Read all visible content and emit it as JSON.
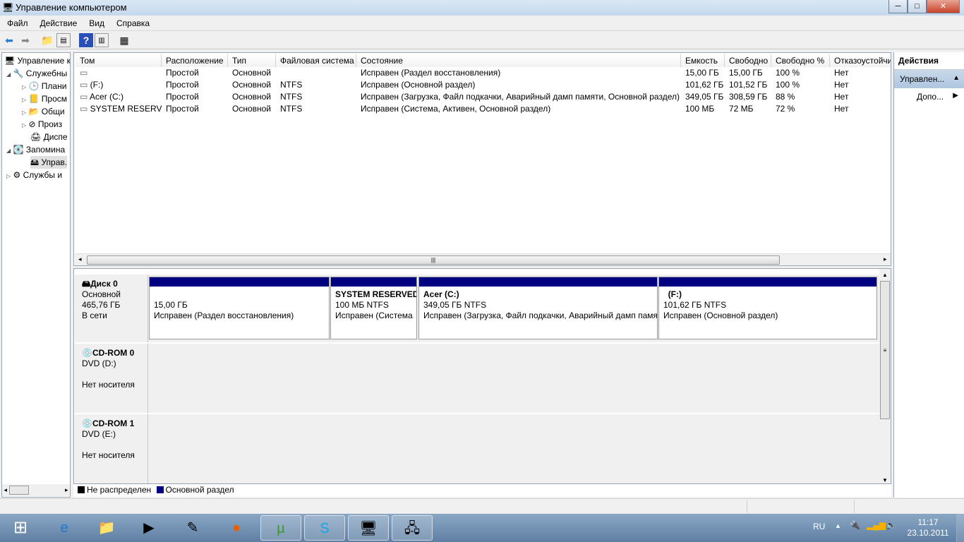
{
  "window": {
    "title": "Управление компьютером",
    "minimize": "─",
    "maximize": "□",
    "close": "✕"
  },
  "menu": [
    "Файл",
    "Действие",
    "Вид",
    "Справка"
  ],
  "tree": [
    {
      "label": "Управление к"
    },
    {
      "label": "Служебны"
    },
    {
      "label": "Плани"
    },
    {
      "label": "Просм"
    },
    {
      "label": "Общи"
    },
    {
      "label": "Произ"
    },
    {
      "label": "Диспе"
    },
    {
      "label": "Запомина"
    },
    {
      "label": "Управ."
    },
    {
      "label": "Службы и"
    }
  ],
  "list": {
    "columns": [
      "Том",
      "Расположение",
      "Тип",
      "Файловая система",
      "Состояние",
      "Емкость",
      "Свободно",
      "Свободно %",
      "Отказоустойчи"
    ],
    "rows": [
      [
        "",
        "Простой",
        "Основной",
        "",
        "Исправен (Раздел восстановления)",
        "15,00 ГБ",
        "15,00 ГБ",
        "100 %",
        "Нет"
      ],
      [
        "(F:)",
        "Простой",
        "Основной",
        "NTFS",
        "Исправен (Основной раздел)",
        "101,62 ГБ",
        "101,52 ГБ",
        "100 %",
        "Нет"
      ],
      [
        "Acer (C:)",
        "Простой",
        "Основной",
        "NTFS",
        "Исправен (Загрузка, Файл подкачки, Аварийный дамп памяти, Основной раздел)",
        "349,05 ГБ",
        "308,59 ГБ",
        "88 %",
        "Нет"
      ],
      [
        "SYSTEM RESERVED",
        "Простой",
        "Основной",
        "NTFS",
        "Исправен (Система, Активен, Основной раздел)",
        "100 МБ",
        "72 МБ",
        "72 %",
        "Нет"
      ]
    ]
  },
  "disks": [
    {
      "name": "Диск 0",
      "type": "Основной",
      "size": "465,76 ГБ",
      "status": "В сети",
      "partitions": [
        {
          "title": "",
          "size": "15,00 ГБ",
          "state": "Исправен (Раздел восстановления)"
        },
        {
          "title": "SYSTEM RESERVED",
          "size": "100 МБ NTFS",
          "state": "Исправен (Система"
        },
        {
          "title": "Acer  (C:)",
          "size": "349,05 ГБ NTFS",
          "state": "Исправен (Загрузка, Файл подкачки, Аварийный дамп памя"
        },
        {
          "title": "(F:)",
          "size": "101,62 ГБ NTFS",
          "state": "Исправен (Основной раздел)"
        }
      ]
    },
    {
      "name": "CD-ROM 0",
      "type": "DVD (D:)",
      "status": "Нет носителя"
    },
    {
      "name": "CD-ROM 1",
      "type": "DVD (E:)",
      "status": "Нет носителя"
    }
  ],
  "legend": [
    {
      "label": "Не распределен",
      "color": "#000000"
    },
    {
      "label": "Основной раздел",
      "color": "#000080"
    }
  ],
  "actions": {
    "header": "Действия",
    "section": "Управлен...",
    "item": "Допо..."
  },
  "tray": {
    "lang": "RU",
    "time": "11:17",
    "date": "23.10.2011"
  }
}
